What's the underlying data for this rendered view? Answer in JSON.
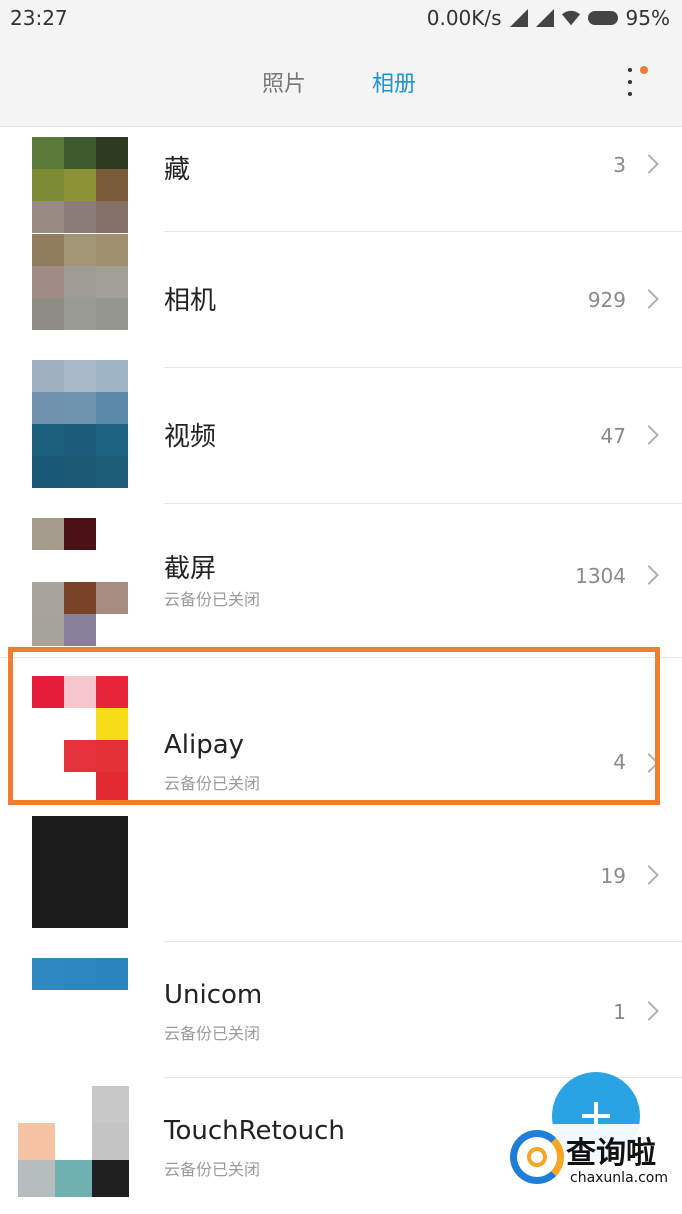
{
  "status_bar": {
    "time": "23:27",
    "network_speed": "0.00K/s",
    "battery": "95%"
  },
  "header": {
    "tabs": [
      {
        "label": "照片",
        "active": false
      },
      {
        "label": "相册",
        "active": true
      }
    ],
    "more_icon": "more-vertical-icon",
    "accent_color": "#1e95d4",
    "badge_color": "#f07b36"
  },
  "albums": [
    {
      "name": "藏",
      "count": "3",
      "subtitle": ""
    },
    {
      "name": "相机",
      "count": "929",
      "subtitle": ""
    },
    {
      "name": "视频",
      "count": "47",
      "subtitle": ""
    },
    {
      "name": "截屏",
      "count": "1304",
      "subtitle": "云备份已关闭"
    },
    {
      "name": "Alipay",
      "count": "4",
      "subtitle": "云备份已关闭",
      "highlighted": true
    },
    {
      "name": "",
      "count": "19",
      "subtitle": ""
    },
    {
      "name": "Unicom",
      "count": "1",
      "subtitle": "云备份已关闭"
    },
    {
      "name": "TouchRetouch",
      "count": "",
      "subtitle": "云备份已关闭"
    }
  ],
  "highlight_color": "#f17d2f",
  "fab": {
    "icon": "plus-icon",
    "color": "#2aa3e4"
  },
  "watermark": {
    "cn": "查询啦",
    "en": "chaxunla.com"
  }
}
